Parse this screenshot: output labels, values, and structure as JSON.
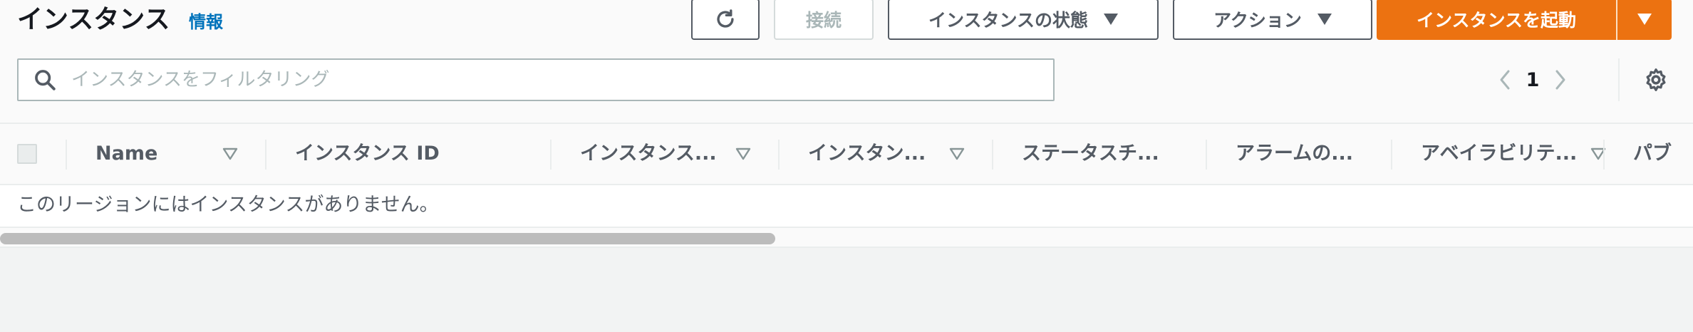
{
  "header": {
    "title": "インスタンス",
    "info_link": "情報"
  },
  "toolbar": {
    "refresh_icon": "refresh-icon",
    "connect_label": "接続",
    "instance_state_label": "インスタンスの状態",
    "actions_label": "アクション",
    "launch_label": "インスタンスを起動",
    "colors": {
      "primary": "#ec7211",
      "link": "#0073bb"
    }
  },
  "search": {
    "placeholder": "インスタンスをフィルタリング",
    "value": ""
  },
  "pagination": {
    "current_page": "1",
    "prev_icon": "chevron-left-icon",
    "next_icon": "chevron-right-icon",
    "settings_icon": "gear-icon"
  },
  "table": {
    "columns": [
      {
        "label": "Name",
        "sortable": true
      },
      {
        "label": "インスタンス ID",
        "sortable": false
      },
      {
        "label": "インスタンス...",
        "sortable": true
      },
      {
        "label": "インスタン...",
        "sortable": true
      },
      {
        "label": "ステータスチ...",
        "sortable": false
      },
      {
        "label": "アラームの...",
        "sortable": false
      },
      {
        "label": "アベイラビリテ...",
        "sortable": true
      },
      {
        "label": "パブ",
        "sortable": false
      }
    ],
    "empty_message": "このリージョンにはインスタンスがありません。"
  }
}
